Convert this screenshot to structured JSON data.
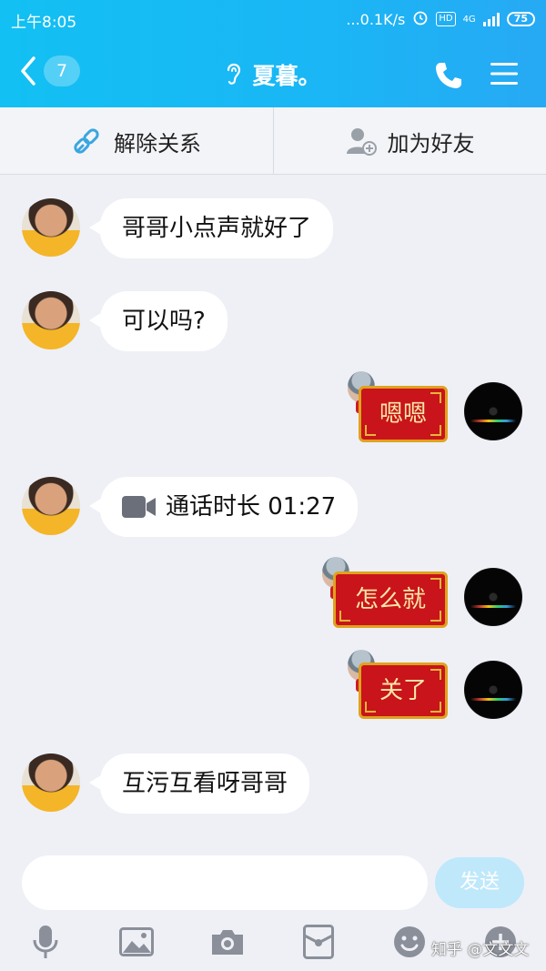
{
  "status": {
    "time": "上午8:05",
    "speed": "...0.1K/s",
    "hd": "HD",
    "net": "4G",
    "battery": "75"
  },
  "header": {
    "back_count": "7",
    "title": "夏暮。"
  },
  "actions": {
    "unbind": "解除关系",
    "add_friend": "加为好友"
  },
  "messages": [
    {
      "from": "other",
      "text": "哥哥小点声就好了"
    },
    {
      "from": "other",
      "text": "可以吗?"
    },
    {
      "from": "me",
      "text": "嗯嗯"
    },
    {
      "from": "other",
      "type": "video-call",
      "text": "通话时长 01:27"
    },
    {
      "from": "me",
      "text": "怎么就"
    },
    {
      "from": "me",
      "text": "关了"
    },
    {
      "from": "other",
      "text": "互污互看呀哥哥"
    }
  ],
  "input": {
    "send_label": "发送",
    "placeholder": ""
  },
  "toolbar": [
    "mic-icon",
    "image-icon",
    "camera-icon",
    "red-packet-icon",
    "emoji-icon",
    "plus-icon"
  ],
  "watermark": "知乎 @文文文",
  "colors": {
    "header": "#12c0f3",
    "accent": "#1ab6f5",
    "red_bubble": "#c8141a",
    "gold": "#e0a21e"
  }
}
